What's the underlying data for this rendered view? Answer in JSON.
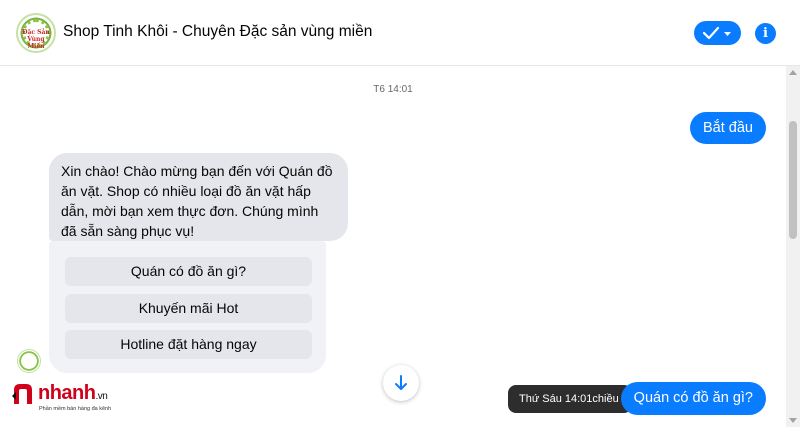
{
  "header": {
    "title": "Shop Tinh Khôi - Chuyên Đặc sản vùng miền",
    "avatar_text": "Đặc Sản Vùng Miền",
    "info_label": "i"
  },
  "conversation": {
    "timestamp": "T6 14:01",
    "outgoing": [
      {
        "text": "Bắt đầu"
      },
      {
        "text": "Quán có đồ ăn gì?"
      }
    ],
    "incoming_message": "Xin chào! Chào mừng bạn đến với Quán đồ ăn vặt. Shop có nhiều loại đồ ăn vặt hấp dẫn, mời bạn xem thực đơn. Chúng mình đã sẵn sàng phục vụ!",
    "quick_replies": [
      {
        "label": "Quán có đồ ăn gì?"
      },
      {
        "label": "Khuyến mãi Hot"
      },
      {
        "label": "Hotline đặt hàng ngay"
      }
    ],
    "tooltip": "Thứ Sáu 14:01chiều"
  },
  "watermark": {
    "brand_main": "nhanh",
    "brand_suffix": ".vn",
    "tagline": "Phần mềm bán hàng đa kênh"
  },
  "colors": {
    "accent": "#0a7cff",
    "incoming_bubble": "#e4e6eb",
    "tooltip_bg": "#2d2d2d",
    "brand_red": "#d0021b"
  },
  "icons": {
    "check": "check-icon",
    "dropdown": "chevron-down-icon",
    "info": "info-icon",
    "scroll_down": "arrow-down-icon"
  }
}
